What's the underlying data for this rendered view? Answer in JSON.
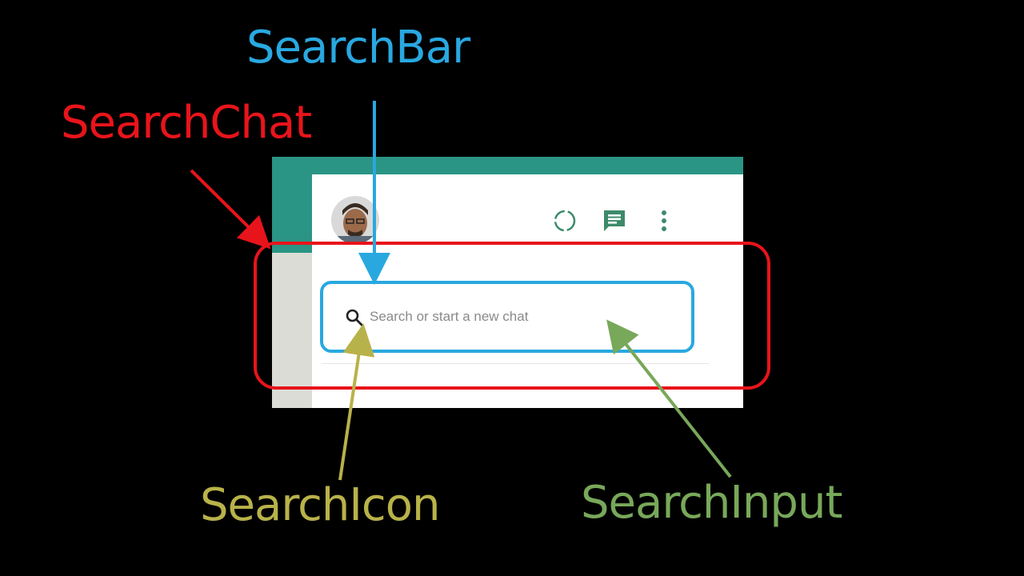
{
  "annotations": {
    "search_bar_label": "SearchBar",
    "search_chat_label": "SearchChat",
    "search_icon_label": "SearchIcon",
    "search_input_label": "SearchInput"
  },
  "colors": {
    "search_bar": "#29a8e0",
    "search_chat": "#e8141b",
    "search_icon": "#b8b24a",
    "search_input": "#78a85a",
    "whatsapp_teal": "#2a9585",
    "icon_green": "#3d8a6a"
  },
  "app": {
    "header": {
      "avatar": "avatar-photo",
      "icons": [
        "status-icon",
        "new-chat-icon",
        "menu-icon"
      ]
    },
    "search": {
      "icon": "search-icon",
      "placeholder": "Search or start a new chat"
    }
  }
}
